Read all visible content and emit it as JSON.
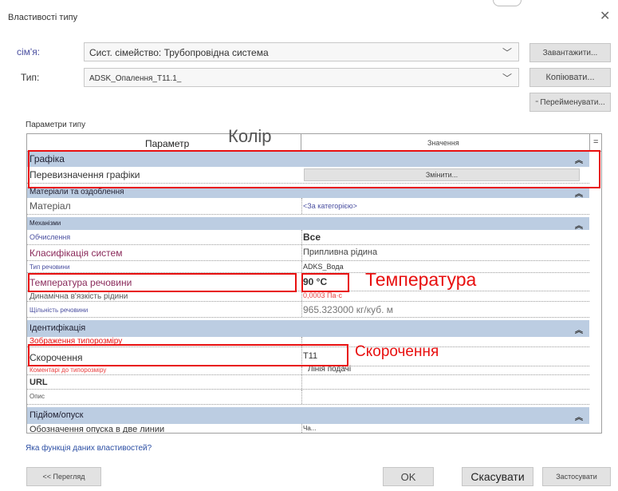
{
  "dialog": {
    "title": "Властивості типу"
  },
  "family": {
    "label": "сім'я:",
    "value": "Сист. сімейство: Трубопровідна система",
    "load_button": "Завантажити..."
  },
  "type": {
    "label": "Тип:",
    "value": "ADSK_Опалення_Т11.1_",
    "copy_button": "Копіювати...",
    "rename_button": "Перейменувати..."
  },
  "params": {
    "section_label": "Параметри типу",
    "col_param": "Параметр",
    "col_value": "Значення",
    "col_extra": "="
  },
  "annotations": {
    "color": "Колір",
    "temperature": "Температура",
    "abbrev": "Скорочення"
  },
  "groups": {
    "graphics": "Графіка",
    "materials": "Матеріали та оздоблення",
    "mechanisms": "Механізми",
    "identification": "Ідентифікація",
    "rise": "Підйом/опуск"
  },
  "rows": {
    "graphics_override": {
      "name": "Перевизначення графіки",
      "button": "Змінити..."
    },
    "material": {
      "name": "Матеріал",
      "value": "<За категорією>"
    },
    "calculation": {
      "name": "Обчислення",
      "value": "Все"
    },
    "system_class": {
      "name": "Класифікація систем",
      "value": "Припливна рідина"
    },
    "fluid_type": {
      "name": "Тип речовини",
      "value": "ADKS_Вода"
    },
    "fluid_temp": {
      "name": "Температура речовини",
      "value": "90 °C"
    },
    "viscosity": {
      "name": "Динамічна в'язкість рідини",
      "value": "0,0003 Па·с"
    },
    "density": {
      "name": "Щільність речовини",
      "value": "965.323000 кг/куб. м"
    },
    "size_image": {
      "name": "Зображення типорозміру",
      "value": ""
    },
    "abbreviation": {
      "name": "Скорочення",
      "value": "Т11"
    },
    "size_comment": {
      "name": "Коментарі до типорозміру",
      "value": "Лінія подачі"
    },
    "url": {
      "name": "URL",
      "value": ""
    },
    "description": {
      "name": "Опис",
      "value": ""
    },
    "rise_symbol": {
      "name": "Обозначення опуска в две линии",
      "value": "Ча..."
    }
  },
  "footer": {
    "help_link": "Яка функція даних властивостей?",
    "preview_button": "<< Перегляд",
    "ok_button": "OK",
    "cancel_button": "Скасувати",
    "apply_button": "Застосувати"
  }
}
